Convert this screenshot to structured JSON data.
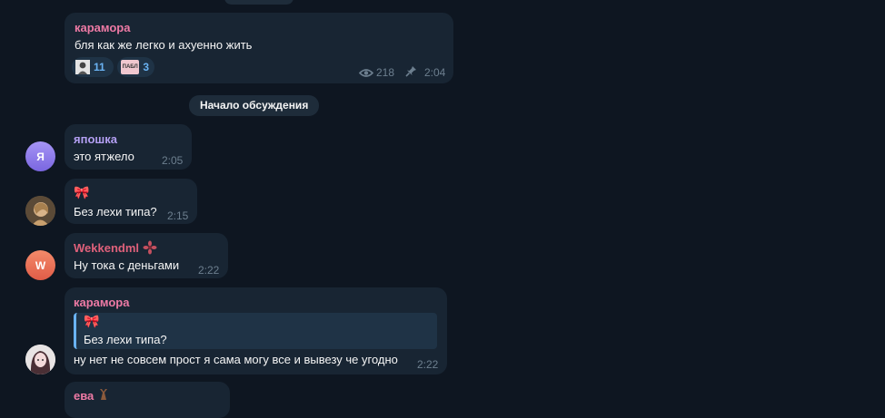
{
  "colors": {
    "background": "#0e1621",
    "bubble": "#182533",
    "accent": "#6ab3f3"
  },
  "messages": [
    {
      "author": "карамора",
      "author_color": "#ee7aa5",
      "text": "бля как же легко и ахуенно жить",
      "reactions": [
        {
          "icon": "sticker-icon",
          "count": "11"
        },
        {
          "icon": "sticker-icon",
          "count": "3",
          "sticker_text": "ПАБЛ"
        }
      ],
      "views": "218",
      "time": "2:04"
    },
    {
      "author": "япошка",
      "author_color": "#b39ff3",
      "avatar_letter": "Я",
      "text": "это ятжело",
      "time": "2:05"
    },
    {
      "author": "🎀",
      "text": "Без лехи типа?",
      "time": "2:15"
    },
    {
      "author": "Wekkendml",
      "author_color": "#e0617b",
      "avatar_letter": "W",
      "text": "Ну тока с деньгами",
      "time": "2:22"
    },
    {
      "author": "карамора",
      "author_color": "#ee7aa5",
      "reply_author": "🎀",
      "reply_text": "Без лехи типа?",
      "text": "ну нет не совсем прост я сама могу все и вывезу че угодно",
      "time": "2:22"
    },
    {
      "author": "ева"
    }
  ],
  "divider": {
    "label": "Начало обсуждения"
  }
}
